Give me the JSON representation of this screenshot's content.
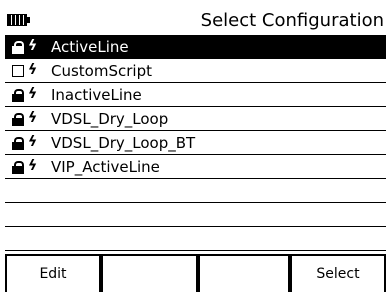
{
  "header": {
    "title": "Select Configuration",
    "battery_icon": "battery-icon"
  },
  "configurations": [
    {
      "label": "ActiveLine",
      "icon": "lock-icon",
      "selected": true
    },
    {
      "label": "CustomScript",
      "icon": "checkbox-icon",
      "selected": false
    },
    {
      "label": "InactiveLine",
      "icon": "lock-icon",
      "selected": false
    },
    {
      "label": "VDSL_Dry_Loop",
      "icon": "lock-icon",
      "selected": false
    },
    {
      "label": "VDSL_Dry_Loop_BT",
      "icon": "lock-icon",
      "selected": false
    },
    {
      "label": "VIP_ActiveLine",
      "icon": "lock-icon",
      "selected": false
    }
  ],
  "softkeys": [
    {
      "label": "Edit"
    },
    {
      "label": ""
    },
    {
      "label": ""
    },
    {
      "label": "Select"
    }
  ],
  "colors": {
    "selected_bg": "#000000",
    "selected_fg": "#ffffff",
    "background": "#ffffff"
  }
}
